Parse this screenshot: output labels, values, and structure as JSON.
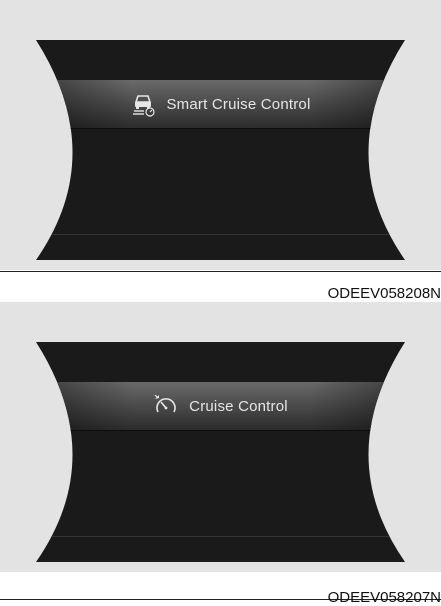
{
  "figures": [
    {
      "menu_label": "Smart Cruise Control",
      "icon": "smart-cruise-control-icon",
      "caption": "ODEEV058208N"
    },
    {
      "menu_label": "Cruise Control",
      "icon": "cruise-control-icon",
      "caption": "ODEEV058207N"
    }
  ],
  "colors": {
    "background": "#e3e3e3",
    "display": "#1a1a1a",
    "highlight": "#4d4d4d",
    "text": "#e6e6e6"
  }
}
